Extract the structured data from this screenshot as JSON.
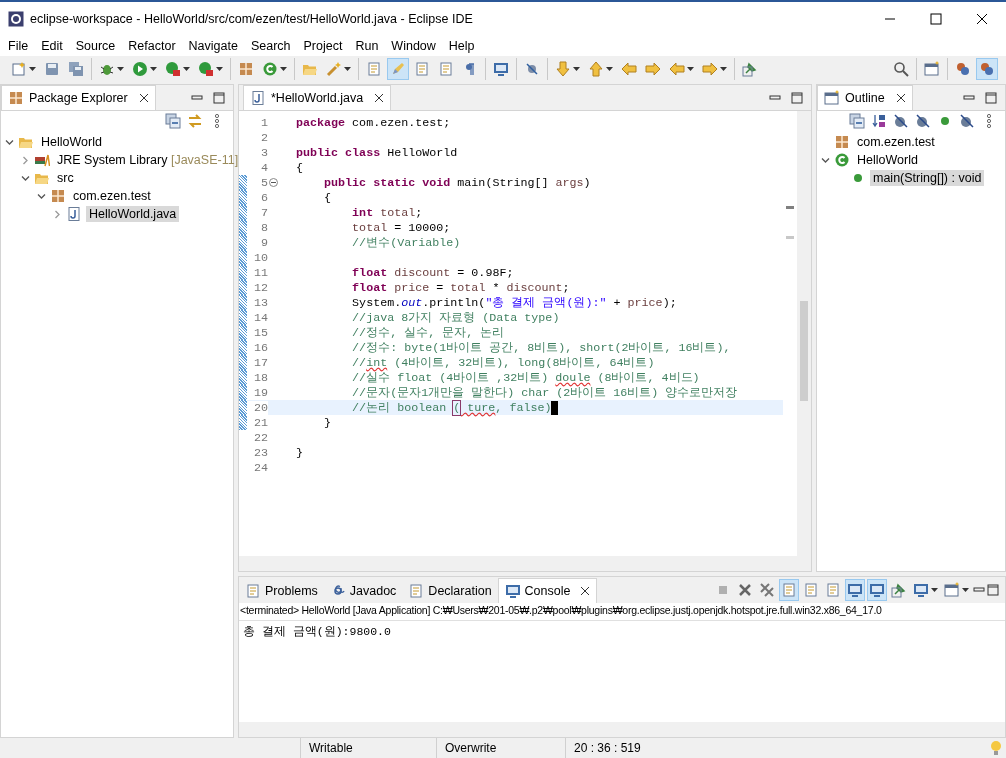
{
  "window": {
    "title": "eclipse-workspace - HelloWorld/src/com/ezen/test/HelloWorld.java - Eclipse IDE"
  },
  "menu": [
    "File",
    "Edit",
    "Source",
    "Refactor",
    "Navigate",
    "Search",
    "Project",
    "Run",
    "Window",
    "Help"
  ],
  "toolbar": {
    "left": [
      [
        {
          "kind": "new",
          "dropdown": true,
          "on": false
        },
        {
          "kind": "save",
          "dropdown": false,
          "on": false
        },
        {
          "kind": "save-all",
          "dropdown": false,
          "on": false
        }
      ],
      [
        {
          "kind": "debug",
          "dropdown": true,
          "on": false
        },
        {
          "kind": "run",
          "dropdown": true,
          "on": false
        },
        {
          "kind": "coverage",
          "dropdown": true,
          "on": false
        },
        {
          "kind": "external",
          "dropdown": true,
          "on": false
        }
      ],
      [
        {
          "kind": "new-package",
          "dropdown": false,
          "on": false
        },
        {
          "kind": "new-class",
          "dropdown": true,
          "on": false
        }
      ],
      [
        {
          "kind": "open-type",
          "dropdown": false,
          "on": false
        },
        {
          "kind": "wand",
          "dropdown": true,
          "on": false
        }
      ],
      [
        {
          "kind": "task",
          "dropdown": false,
          "on": false
        },
        {
          "kind": "pencil",
          "dropdown": false,
          "on": true
        },
        {
          "kind": "notes",
          "dropdown": false,
          "on": false
        },
        {
          "kind": "page",
          "dropdown": false,
          "on": false
        },
        {
          "kind": "pilcrow",
          "dropdown": false,
          "on": false
        }
      ],
      [
        {
          "kind": "monitor",
          "dropdown": false,
          "on": false
        }
      ],
      [
        {
          "kind": "pin-off",
          "dropdown": false,
          "on": false
        }
      ],
      [
        {
          "kind": "next",
          "dropdown": true,
          "on": false
        },
        {
          "kind": "prev",
          "dropdown": true,
          "on": false
        },
        {
          "kind": "back-edit",
          "dropdown": false,
          "on": false
        },
        {
          "kind": "forward-edit",
          "dropdown": false,
          "on": false
        },
        {
          "kind": "back",
          "dropdown": true,
          "on": false
        },
        {
          "kind": "forward",
          "dropdown": true,
          "on": false
        }
      ],
      [
        {
          "kind": "pin",
          "dropdown": false,
          "on": false
        }
      ]
    ],
    "right": [
      [
        {
          "kind": "search",
          "dropdown": false,
          "on": false
        }
      ],
      [
        {
          "kind": "perspective",
          "dropdown": false,
          "on": false
        }
      ],
      [
        {
          "kind": "java-ee",
          "dropdown": false,
          "on": false
        },
        {
          "kind": "java",
          "dropdown": false,
          "on": true
        }
      ]
    ]
  },
  "package_explorer": {
    "title": "Package Explorer",
    "tree": [
      {
        "kind": "project",
        "label": "HelloWorld",
        "expanded": true,
        "selected": false,
        "children": [
          {
            "kind": "library",
            "label": "JRE System Library",
            "suffix": "[JavaSE-11]",
            "expanded": false,
            "selected": false
          },
          {
            "kind": "source",
            "label": "src",
            "expanded": true,
            "selected": false,
            "children": [
              {
                "kind": "package",
                "label": "com.ezen.test",
                "expanded": true,
                "selected": false,
                "children": [
                  {
                    "kind": "java",
                    "label": "HelloWorld.java",
                    "expanded": false,
                    "selected": true
                  }
                ]
              }
            ]
          }
        ]
      }
    ]
  },
  "editor": {
    "tab": {
      "label": "*HelloWorld.java"
    },
    "lines": [
      {
        "number": "1",
        "fold": false,
        "changed": false,
        "current": false,
        "tokens": [
          {
            "kind": "keyword",
            "text": "package "
          },
          {
            "kind": "plain",
            "text": "com.ezen.test;"
          }
        ]
      },
      {
        "number": "2",
        "fold": false,
        "changed": false,
        "current": false
      },
      {
        "number": "3",
        "fold": false,
        "changed": false,
        "current": false,
        "tokens": [
          {
            "kind": "keyword",
            "text": "public class "
          },
          {
            "kind": "plain",
            "text": "HelloWorld"
          }
        ]
      },
      {
        "number": "4",
        "fold": false,
        "changed": false,
        "current": false,
        "tokens": [
          {
            "kind": "plain",
            "text": "{"
          }
        ]
      },
      {
        "number": "5",
        "fold": true,
        "changed": true,
        "current": false,
        "tokens": [
          {
            "kind": "keyword",
            "text": "    public static void "
          },
          {
            "kind": "plain",
            "text": "main(String[] "
          },
          {
            "kind": "var",
            "text": "args"
          },
          {
            "kind": "plain",
            "text": ")"
          }
        ]
      },
      {
        "number": "6",
        "fold": false,
        "changed": true,
        "current": false,
        "tokens": [
          {
            "kind": "plain",
            "text": "    {"
          }
        ]
      },
      {
        "number": "7",
        "fold": false,
        "changed": true,
        "current": false,
        "tokens": [
          {
            "kind": "keyword",
            "text": "        int "
          },
          {
            "kind": "var",
            "text": "total"
          },
          {
            "kind": "plain",
            "text": ";"
          }
        ]
      },
      {
        "number": "8",
        "fold": false,
        "changed": true,
        "current": false,
        "tokens": [
          {
            "kind": "var",
            "text": "        total"
          },
          {
            "kind": "plain",
            "text": " = 10000;"
          }
        ]
      },
      {
        "number": "9",
        "fold": false,
        "changed": true,
        "current": false,
        "tokens": [
          {
            "kind": "comment",
            "text": "        //변수(Variable)"
          }
        ]
      },
      {
        "number": "10",
        "fold": false,
        "changed": true,
        "current": false
      },
      {
        "number": "11",
        "fold": false,
        "changed": true,
        "current": false,
        "tokens": [
          {
            "kind": "keyword",
            "text": "        float "
          },
          {
            "kind": "var",
            "text": "discount"
          },
          {
            "kind": "plain",
            "text": " = 0.98F;"
          }
        ]
      },
      {
        "number": "12",
        "fold": false,
        "changed": true,
        "current": false,
        "tokens": [
          {
            "kind": "keyword",
            "text": "        float "
          },
          {
            "kind": "var",
            "text": "price"
          },
          {
            "kind": "plain",
            "text": " = "
          },
          {
            "kind": "var",
            "text": "total"
          },
          {
            "kind": "plain",
            "text": " * "
          },
          {
            "kind": "var",
            "text": "discount"
          },
          {
            "kind": "plain",
            "text": ";"
          }
        ]
      },
      {
        "number": "13",
        "fold": false,
        "changed": true,
        "current": false,
        "tokens": [
          {
            "kind": "plain",
            "text": "        System."
          },
          {
            "kind": "field",
            "text": "out"
          },
          {
            "kind": "plain",
            "text": ".println("
          },
          {
            "kind": "string",
            "text": "\"총 결제 금액(원):\""
          },
          {
            "kind": "plain",
            "text": " + "
          },
          {
            "kind": "var",
            "text": "price"
          },
          {
            "kind": "plain",
            "text": ");"
          }
        ]
      },
      {
        "number": "14",
        "fold": false,
        "changed": true,
        "current": false,
        "tokens": [
          {
            "kind": "comment",
            "text": "        //java 8가지 자료형 (Data type)"
          }
        ]
      },
      {
        "number": "15",
        "fold": false,
        "changed": true,
        "current": false,
        "tokens": [
          {
            "kind": "comment",
            "text": "        //정수, 실수, 문자, 논리"
          }
        ]
      },
      {
        "number": "16",
        "fold": false,
        "changed": true,
        "current": false,
        "tokens": [
          {
            "kind": "comment",
            "text": "        //정수: byte(1바이트 공간, 8비트), short(2바이트, 16비트),"
          }
        ]
      },
      {
        "number": "17",
        "fold": false,
        "changed": true,
        "current": false,
        "tokens": [
          {
            "kind": "comment",
            "text": "        //"
          },
          {
            "kind": "typo",
            "text": "int"
          },
          {
            "kind": "comment",
            "text": " (4바이트, 32비트), long(8바이트, 64비트)"
          }
        ]
      },
      {
        "number": "18",
        "fold": false,
        "changed": true,
        "current": false,
        "tokens": [
          {
            "kind": "comment",
            "text": "        //실수 float (4바이트 ,32비트) "
          },
          {
            "kind": "typo",
            "text": "doule"
          },
          {
            "kind": "comment",
            "text": " (8바이트, 4비드)"
          }
        ]
      },
      {
        "number": "19",
        "fold": false,
        "changed": true,
        "current": false,
        "tokens": [
          {
            "kind": "comment",
            "text": "        //문자(문자1개만을 말한다) char (2바이트 16비트) 양수로만저장"
          }
        ]
      },
      {
        "number": "20",
        "fold": false,
        "changed": true,
        "current": true,
        "tokens": [
          {
            "kind": "comment",
            "text": "        //논리 boolean "
          },
          {
            "kind": "bracket",
            "text": "("
          },
          {
            "kind": "typo",
            "text": " ture"
          },
          {
            "kind": "comment",
            "text": ", false)"
          }
        ]
      },
      {
        "number": "21",
        "fold": false,
        "changed": true,
        "current": false,
        "tokens": [
          {
            "kind": "plain",
            "text": "    }"
          }
        ]
      },
      {
        "number": "22",
        "fold": false,
        "changed": false,
        "current": false
      },
      {
        "number": "23",
        "fold": false,
        "changed": false,
        "current": false,
        "tokens": [
          {
            "kind": "plain",
            "text": "}"
          }
        ]
      },
      {
        "number": "24",
        "fold": false,
        "changed": false,
        "current": false
      }
    ]
  },
  "outline": {
    "title": "Outline",
    "tree": [
      {
        "kind": "package",
        "label": "com.ezen.test",
        "selected": false
      },
      {
        "kind": "class",
        "label": "HelloWorld",
        "expanded": true,
        "selected": false,
        "children": [
          {
            "kind": "method",
            "label": "main(String[]) : void",
            "selected": true
          }
        ]
      }
    ]
  },
  "console": {
    "tabs": [
      {
        "kind": "problems",
        "label": "Problems",
        "selected": false
      },
      {
        "kind": "javadoc",
        "label": "Javadoc",
        "selected": false
      },
      {
        "kind": "declaration",
        "label": "Declaration",
        "selected": false
      },
      {
        "kind": "console",
        "label": "Console",
        "selected": true
      }
    ],
    "toolbar": [
      {
        "kind": "terminate",
        "dropdown": false,
        "on": false
      },
      {
        "kind": "remove",
        "dropdown": false,
        "on": false
      },
      {
        "kind": "remove-all",
        "dropdown": false,
        "on": false
      },
      {
        "kind": "clear",
        "dropdown": false,
        "on": true
      },
      {
        "kind": "scroll-lock",
        "dropdown": false,
        "on": false
      },
      {
        "kind": "wrap",
        "dropdown": false,
        "on": false
      },
      {
        "kind": "stdout",
        "dropdown": false,
        "on": true
      },
      {
        "kind": "stderr",
        "dropdown": false,
        "on": true
      },
      {
        "kind": "pin",
        "dropdown": false,
        "on": false
      },
      {
        "kind": "display",
        "dropdown": true,
        "on": false
      },
      {
        "kind": "open-console",
        "dropdown": true,
        "on": false
      }
    ],
    "header": "<terminated> HelloWorld [Java Application] C:₩Users₩201-05₩.p2₩pool₩plugins₩org.eclipse.justj.openjdk.hotspot.jre.full.win32.x86_64_17.0",
    "output": "총 결제 금액(원):9800.0"
  },
  "status_bar": {
    "writable": "Writable",
    "insert_mode": "Overwrite",
    "position": "20 : 36 : 519"
  }
}
